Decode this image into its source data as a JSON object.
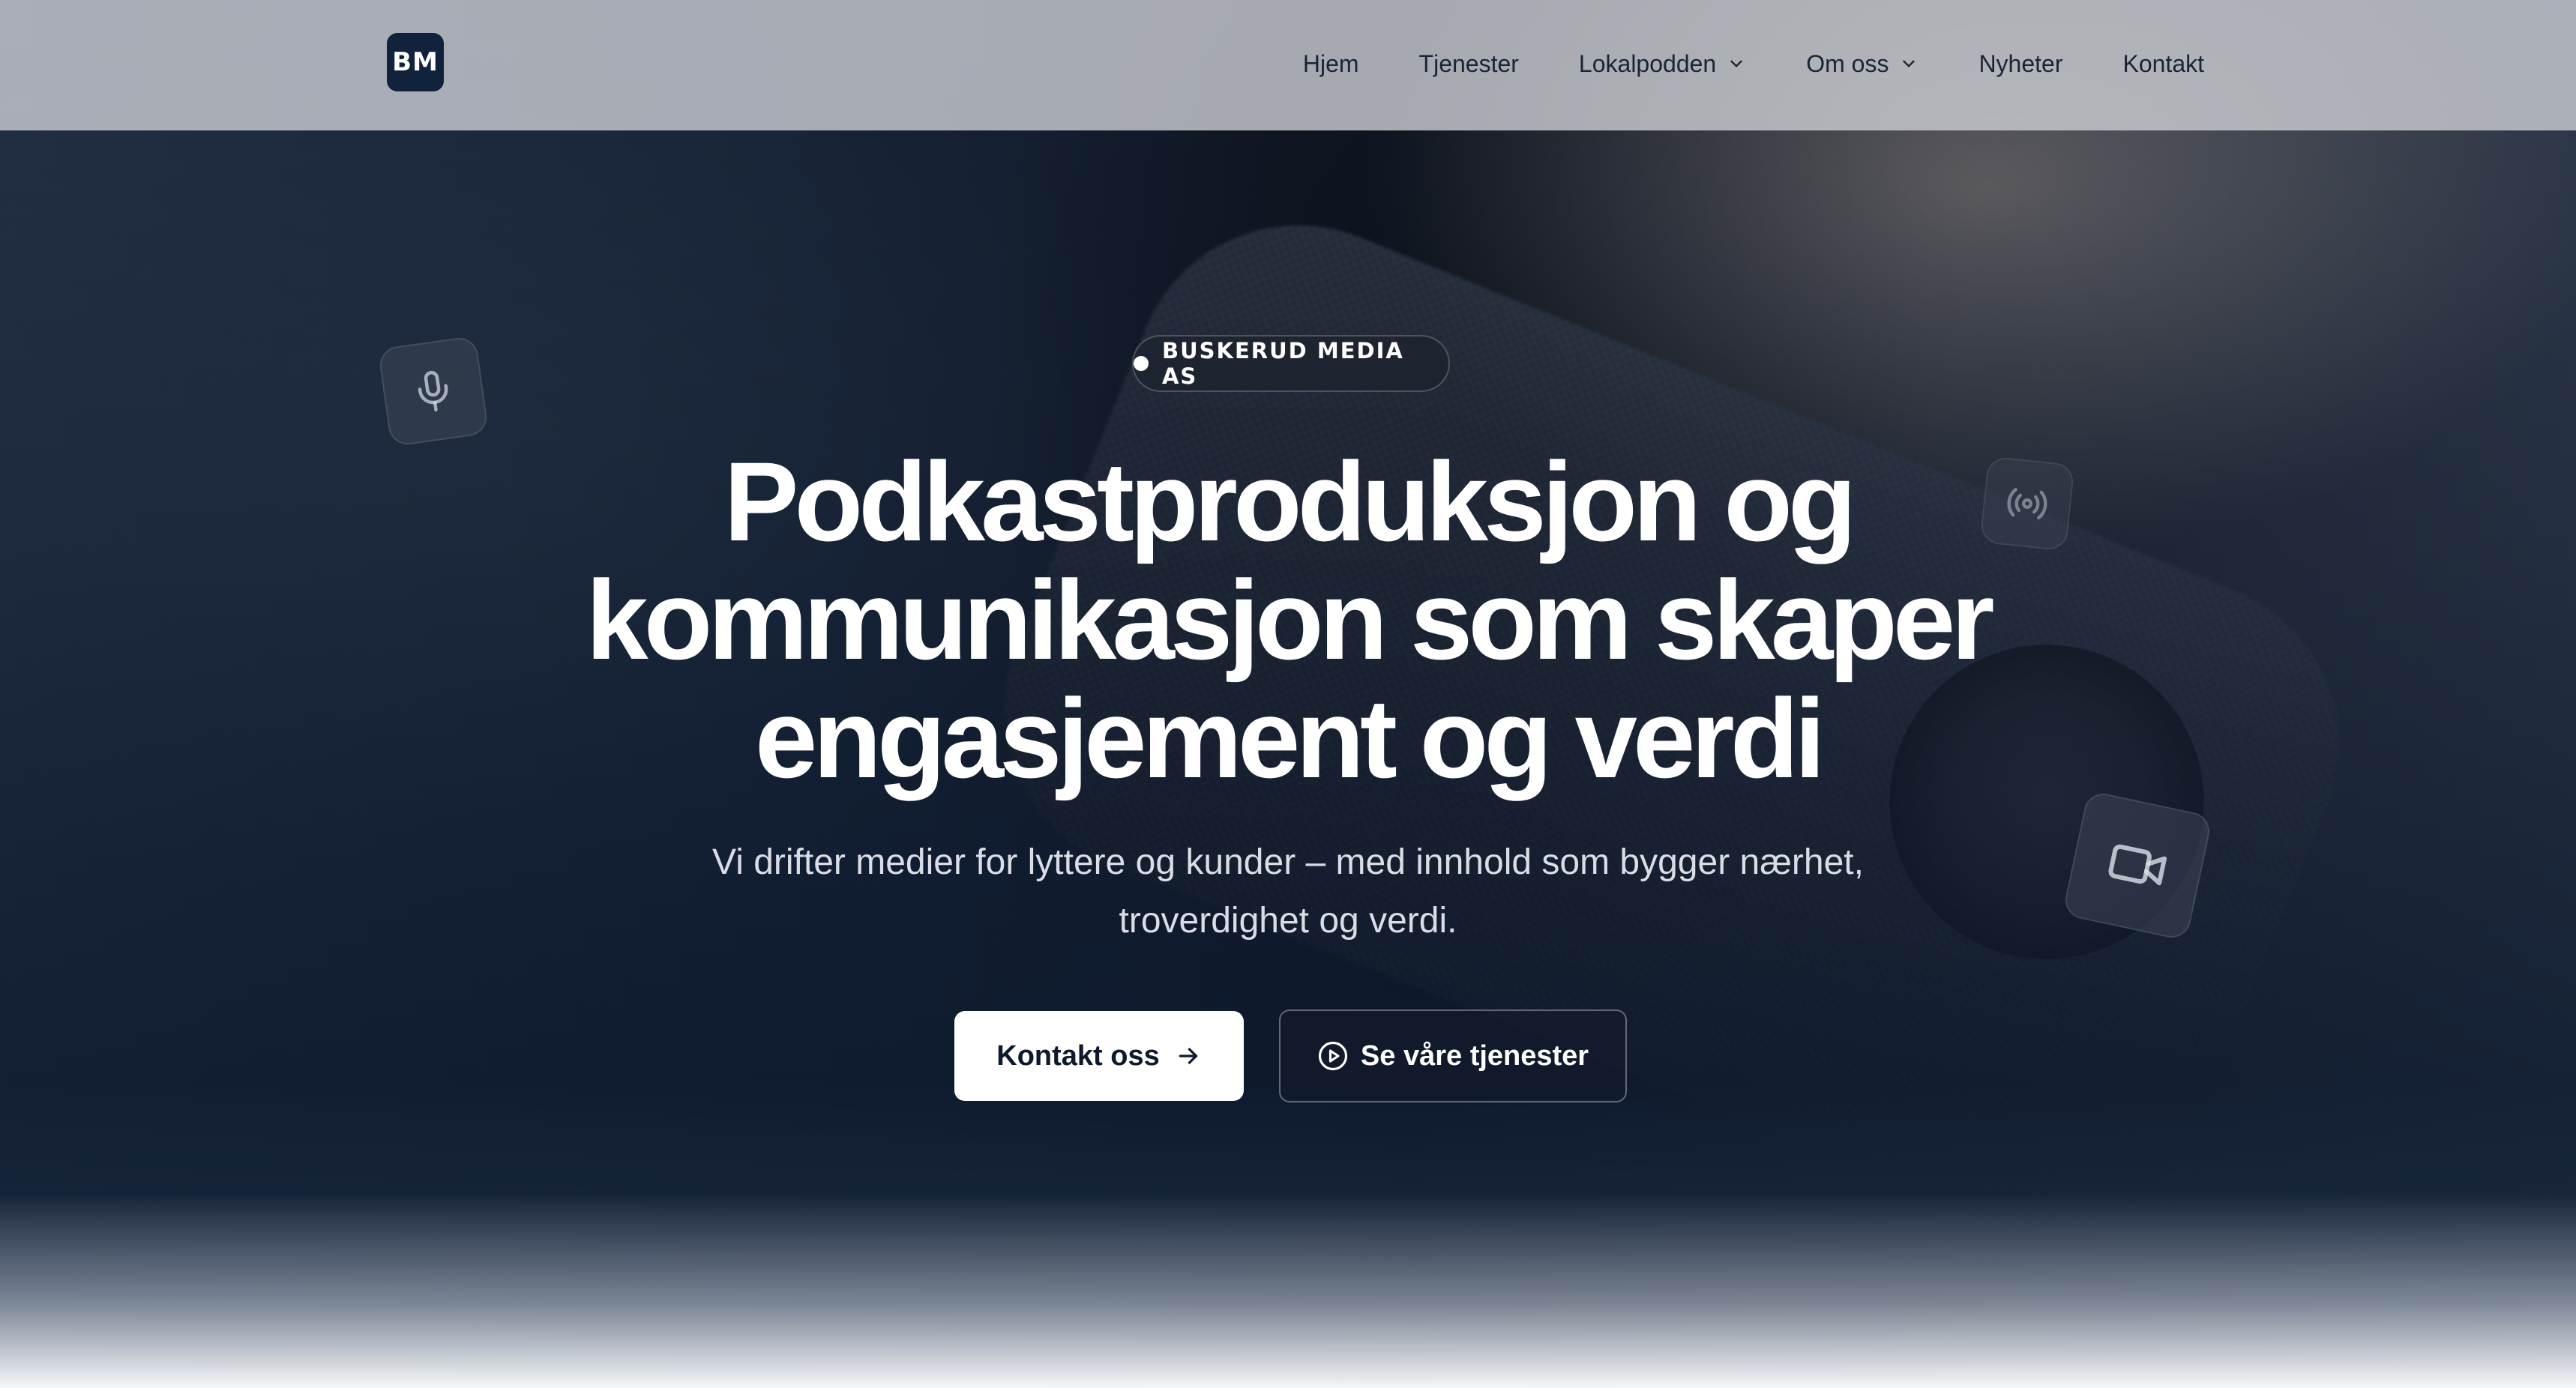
{
  "logo": {
    "text": "BM"
  },
  "nav": {
    "items": [
      {
        "label": "Hjem",
        "dropdown": false
      },
      {
        "label": "Tjenester",
        "dropdown": false
      },
      {
        "label": "Lokalpodden",
        "dropdown": true
      },
      {
        "label": "Om oss",
        "dropdown": true
      },
      {
        "label": "Nyheter",
        "dropdown": false
      },
      {
        "label": "Kontakt",
        "dropdown": false
      }
    ]
  },
  "hero": {
    "badge": "BUSKERUD MEDIA AS",
    "headline_lines": [
      "Podkastproduksjon og",
      "kommunikasjon som skaper",
      "engasjement og verdi"
    ],
    "subline_lines": [
      "Vi drifter medier for lyttere og kunder – med innhold som bygger nærhet,",
      "troverdighet og verdi."
    ],
    "primary_button": "Kontakt oss",
    "secondary_button": "Se våre tjenester"
  },
  "icons": {
    "floating": [
      "microphone-icon",
      "broadcast-icon",
      "video-camera-icon"
    ],
    "primary_button": "arrow-right-icon",
    "secondary_button": "play-circle-icon",
    "nav_dropdown": "chevron-down-icon"
  },
  "colors": {
    "header_bg": "#c8cbd0",
    "logo_bg": "#11223c",
    "nav_text": "#1a2436",
    "hero_text": "#ffffff",
    "primary_button_bg": "#ffffff",
    "primary_button_text": "#0e1a2c"
  }
}
